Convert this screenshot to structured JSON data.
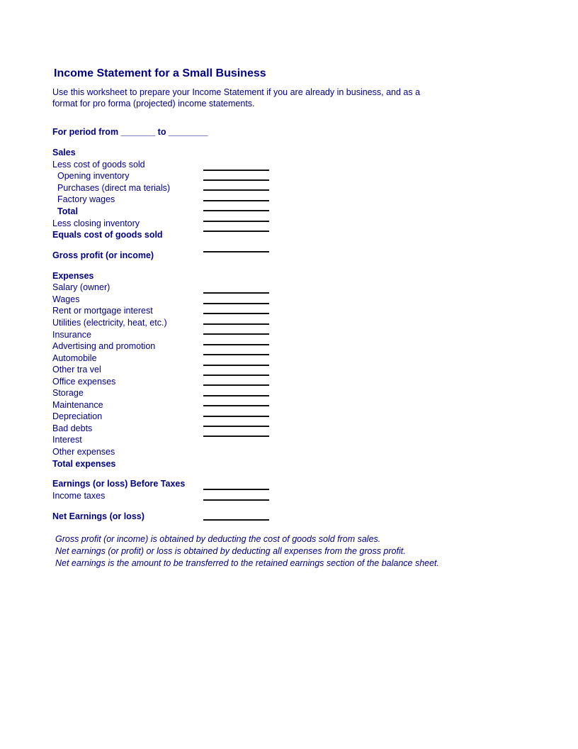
{
  "document": {
    "title": "Income Statement for a Small Business",
    "intro_lines": [
      "Use this worksheet to prepare your Income Statement if you are already in business, and as a",
      "format for pro forma (projected) income statements."
    ],
    "period": "For period from _______ to ________",
    "sales_section": {
      "heading": "Sales",
      "items": [
        {
          "label": "Less cost of goods sold",
          "bold": false,
          "indent": false
        },
        {
          "label": "Opening inventory",
          "bold": false,
          "indent": true
        },
        {
          "label": "Purchases (direct ma terials)",
          "bold": false,
          "indent": true
        },
        {
          "label": "Factory wages",
          "bold": false,
          "indent": true
        },
        {
          "label": "Total",
          "bold": true,
          "indent": true
        },
        {
          "label": "Less closing inventory",
          "bold": false,
          "indent": false
        },
        {
          "label": "Equals cost of goods sold",
          "bold": true,
          "indent": false
        }
      ],
      "gross_profit": "Gross profit (or income)"
    },
    "expenses_section": {
      "heading": "Expenses",
      "items": [
        "Salary (owner)",
        "Wages",
        "Rent or mortgage interest",
        "Utilities (electricity, heat, etc.)",
        "Insurance",
        "Advertising and promotion",
        "Automobile",
        "Other tra vel",
        "Office expenses",
        "Storage",
        "Maintenance",
        "Depreciation",
        "Bad debts",
        "Interest",
        "Other expenses"
      ],
      "total": "Total expenses"
    },
    "earnings_section": {
      "before_taxes": "Earnings (or loss) Before Taxes",
      "income_taxes": "Income taxes",
      "net": "Net Earnings (or loss)"
    },
    "notes": [
      "Gross profit (or income) is obtained by deducting the cost of goods sold from sales.",
      "Net earnings (or profit) or loss is obtained by deducting all expenses from the gross profit.",
      "Net earnings is the amount to be transferred to the retained earnings section of the balance sheet."
    ]
  }
}
